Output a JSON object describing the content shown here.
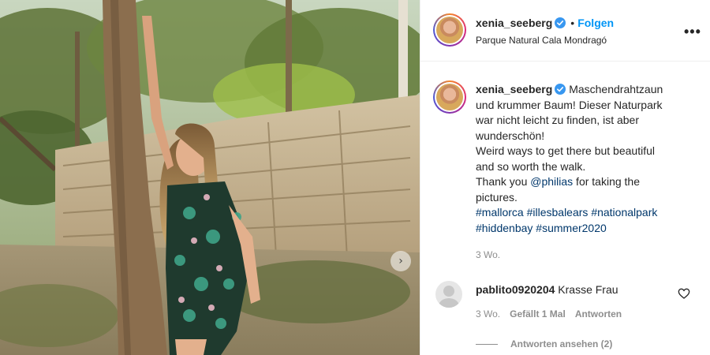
{
  "post": {
    "username": "xenia_seeberg",
    "follow_label": "Folgen",
    "separator": "•",
    "location": "Parque Natural Cala Mondragó",
    "more_glyph": "•••",
    "verified": true
  },
  "caption": {
    "username": "xenia_seeberg",
    "line1": "Maschendrahtzaun",
    "line2": "und krummer Baum! Dieser Naturpark",
    "line3": "war nicht leicht zu finden, ist aber",
    "line4": "wunderschön!",
    "line5": "Weird ways to get there but beautiful",
    "line6": "and so worth the walk.",
    "line7_before": "Thank you ",
    "mention": "@philias",
    "line7_after": " for taking the",
    "line8": "pictures.",
    "hashtags_line1": [
      "#mallorca",
      "#illesbalears",
      "#nationalpark"
    ],
    "hashtags_line2": [
      "#hiddenbay",
      "#summer2020"
    ],
    "time": "3 Wo."
  },
  "comment": {
    "username": "pablito0920204",
    "text": "Krasse Frau",
    "time": "3 Wo.",
    "likes_label": "Gefällt 1 Mal",
    "reply_label": "Antworten",
    "view_replies_label": "Antworten ansehen (2)"
  },
  "carousel": {
    "next_glyph": "›"
  },
  "colors": {
    "link_blue": "#0095f6",
    "hashtag": "#00376b",
    "muted": "#8e8e8e",
    "text": "#262626",
    "verified_badge": "#3897f0"
  }
}
